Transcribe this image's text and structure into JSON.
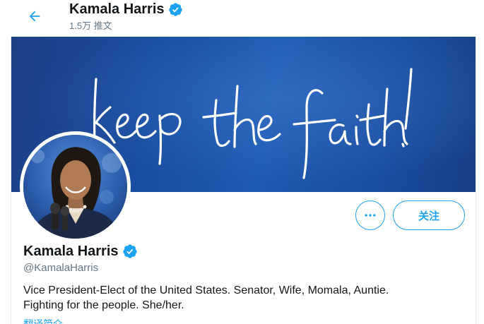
{
  "header": {
    "back_icon": "arrow-left-icon",
    "display_name": "Kamala Harris",
    "tweet_count": "1.5万 推文",
    "verified_icon": "verified-badge-icon"
  },
  "banner": {
    "script_text": "keep the faith!"
  },
  "actions": {
    "more_icon": "more-horizontal-icon",
    "follow_label": "关注"
  },
  "profile": {
    "display_name": "Kamala Harris",
    "handle": "@KamalaHarris",
    "bio_line1": "Vice President-Elect of the United States. Senator, Wife, Momala, Auntie.",
    "bio_line2": "Fighting for the people. She/her.",
    "translate_label": "翻译简介"
  },
  "colors": {
    "accent": "#1da1f2",
    "text": "#14171a",
    "secondary": "#657786",
    "banner": "#1a4fa3"
  }
}
